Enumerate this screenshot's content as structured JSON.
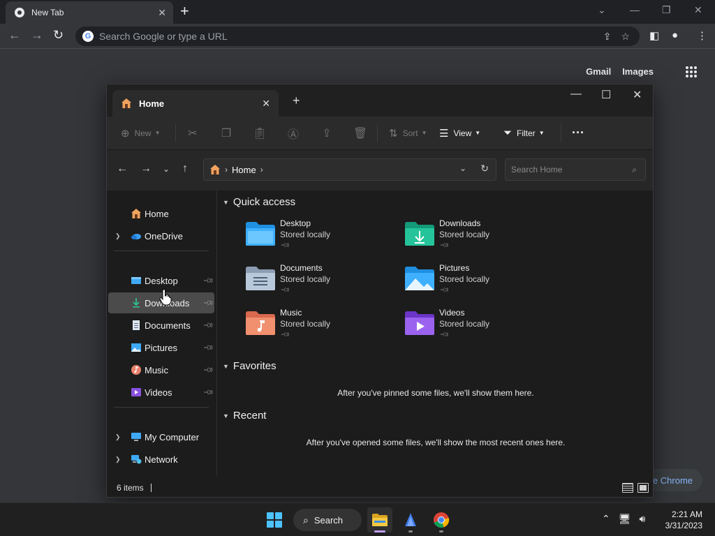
{
  "browser": {
    "tab_title": "New Tab",
    "omnibox_placeholder": "Search Google or type a URL",
    "ntp_links": [
      "Gmail",
      "Images"
    ],
    "customize_label": "e Chrome"
  },
  "explorer": {
    "tab_title": "Home",
    "commands": {
      "new": "New",
      "sort": "Sort",
      "view": "View",
      "filter": "Filter"
    },
    "address": {
      "location": "Home",
      "search_placeholder": "Search Home"
    },
    "nav": {
      "top": [
        {
          "label": "Home"
        },
        {
          "label": "OneDrive"
        }
      ],
      "pinned": [
        {
          "label": "Desktop"
        },
        {
          "label": "Downloads"
        },
        {
          "label": "Documents"
        },
        {
          "label": "Pictures"
        },
        {
          "label": "Music"
        },
        {
          "label": "Videos"
        }
      ],
      "bottom": [
        {
          "label": "My Computer"
        },
        {
          "label": "Network"
        }
      ]
    },
    "sections": {
      "quick_access": "Quick access",
      "favorites": "Favorites",
      "recent": "Recent"
    },
    "quick_access": [
      {
        "name": "Desktop",
        "status": "Stored locally"
      },
      {
        "name": "Downloads",
        "status": "Stored locally"
      },
      {
        "name": "Documents",
        "status": "Stored locally"
      },
      {
        "name": "Pictures",
        "status": "Stored locally"
      },
      {
        "name": "Music",
        "status": "Stored locally"
      },
      {
        "name": "Videos",
        "status": "Stored locally"
      }
    ],
    "favorites_empty": "After you've pinned some files, we'll show them here.",
    "recent_empty": "After you've opened some files, we'll show the most recent ones here.",
    "status": "6 items"
  },
  "taskbar": {
    "search_label": "Search",
    "time": "2:21 AM",
    "date": "3/31/2023"
  },
  "colors": {
    "accent": "#4cc2ff",
    "selection": "#4b4b4b",
    "explorer_bg": "#1c1c1c"
  }
}
